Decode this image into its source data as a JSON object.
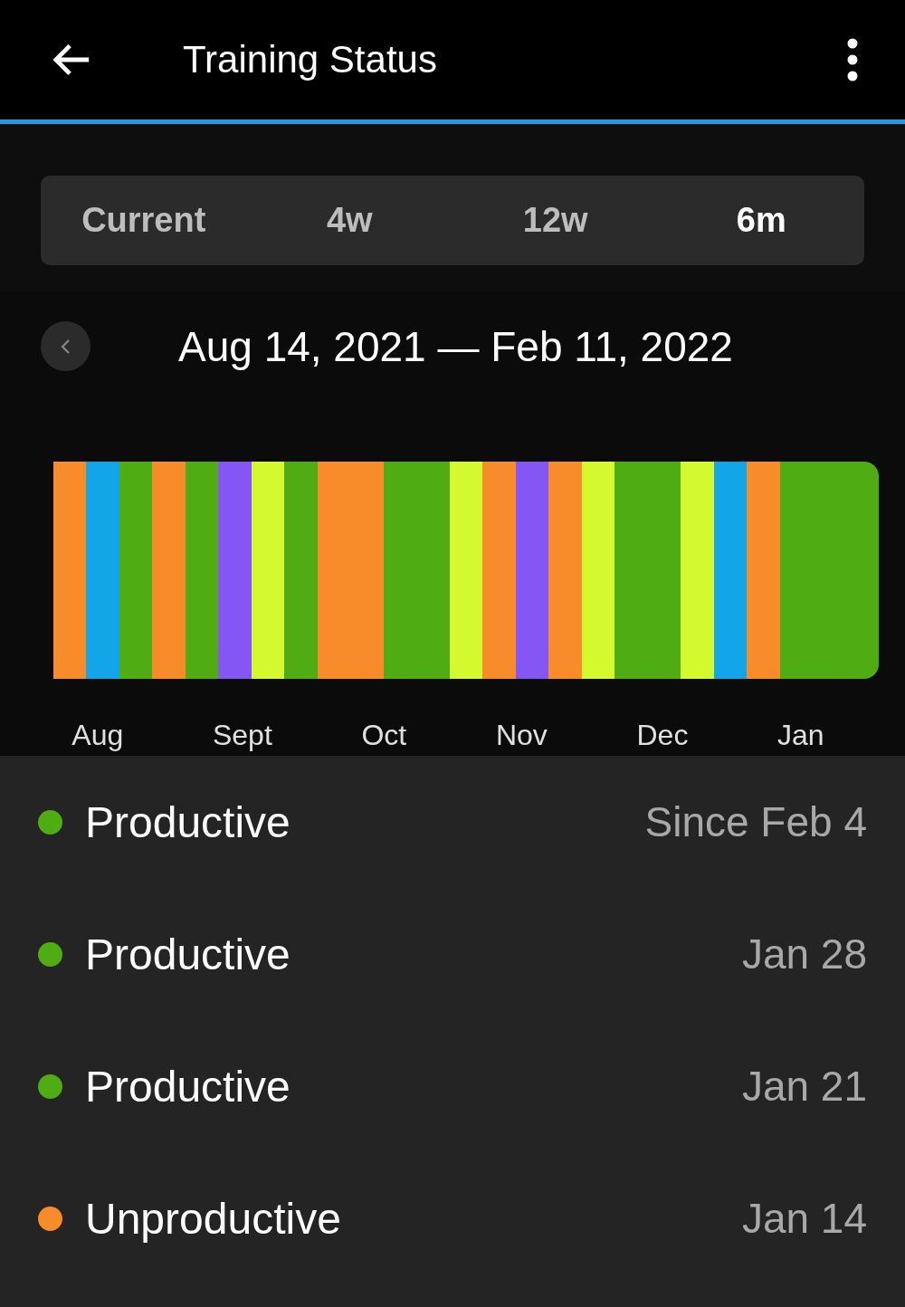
{
  "header": {
    "title": "Training Status"
  },
  "tabs": [
    {
      "label": "Current",
      "selected": false
    },
    {
      "label": "4w",
      "selected": false
    },
    {
      "label": "12w",
      "selected": false
    },
    {
      "label": "6m",
      "selected": true
    }
  ],
  "date_range": "Aug 14, 2021 — Feb 11, 2022",
  "status_strip": [
    {
      "color": "#f88b2a"
    },
    {
      "color": "#12a5e8"
    },
    {
      "color": "#4fad13"
    },
    {
      "color": "#f88b2a"
    },
    {
      "color": "#4fad13"
    },
    {
      "color": "#8457f5"
    },
    {
      "color": "#d5f92f"
    },
    {
      "color": "#4fad13"
    },
    {
      "color": "#f88b2a"
    },
    {
      "color": "#f88b2a"
    },
    {
      "color": "#4fad13"
    },
    {
      "color": "#4fad13"
    },
    {
      "color": "#d5f92f"
    },
    {
      "color": "#f88b2a"
    },
    {
      "color": "#8457f5"
    },
    {
      "color": "#f88b2a"
    },
    {
      "color": "#d5f92f"
    },
    {
      "color": "#4fad13"
    },
    {
      "color": "#4fad13"
    },
    {
      "color": "#d5f92f"
    },
    {
      "color": "#12a5e8"
    },
    {
      "color": "#f88b2a"
    },
    {
      "color": "#4fad13"
    },
    {
      "color": "#4fad13"
    },
    {
      "color": "#4fad13"
    }
  ],
  "months": [
    "Aug",
    "Sept",
    "Oct",
    "Nov",
    "Dec",
    "Jan"
  ],
  "history": [
    {
      "status": "Productive",
      "date": "Since Feb 4",
      "color": "#4fad13"
    },
    {
      "status": "Productive",
      "date": "Jan 28",
      "color": "#4fad13"
    },
    {
      "status": "Productive",
      "date": "Jan 21",
      "color": "#4fad13"
    },
    {
      "status": "Unproductive",
      "date": "Jan 14",
      "color": "#f88b2a"
    }
  ]
}
